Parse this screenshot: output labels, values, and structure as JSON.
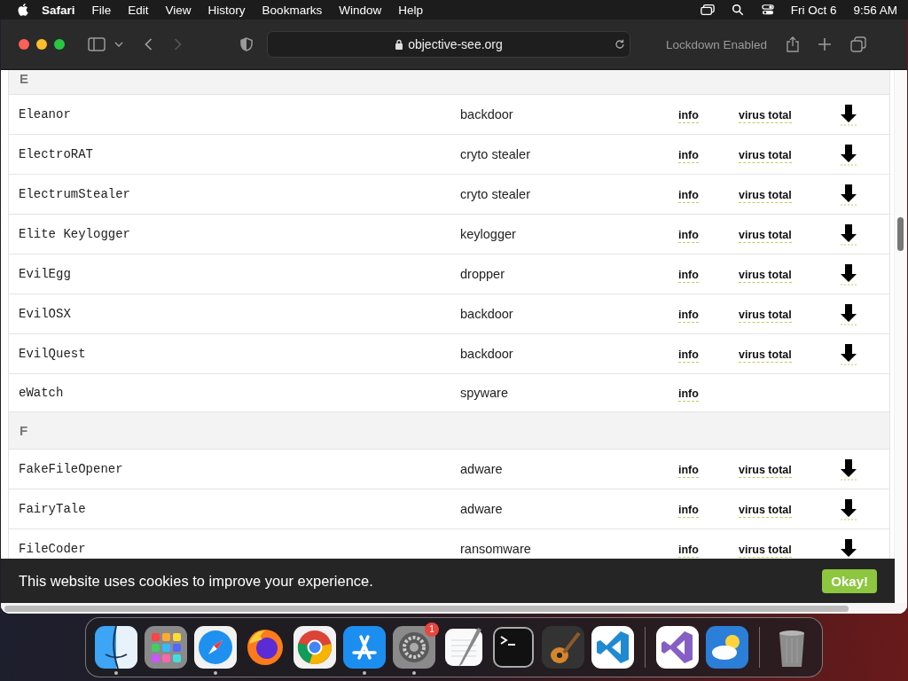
{
  "menubar": {
    "app": "Safari",
    "items": [
      "File",
      "Edit",
      "View",
      "History",
      "Bookmarks",
      "Window",
      "Help"
    ],
    "date": "Fri Oct 6",
    "time": "9:56 AM"
  },
  "toolbar": {
    "address": "objective-see.org",
    "status": "Lockdown Enabled",
    "forward_disabled": true
  },
  "sections": [
    {
      "letter": "E",
      "rows": [
        {
          "name": "Eleanor",
          "type": "backdoor",
          "info": "info",
          "virus_total": "virus total",
          "download": true
        },
        {
          "name": "ElectroRAT",
          "type": "cryto stealer",
          "info": "info",
          "virus_total": "virus total",
          "download": true
        },
        {
          "name": "ElectrumStealer",
          "type": "cryto stealer",
          "info": "info",
          "virus_total": "virus total",
          "download": true
        },
        {
          "name": "Elite Keylogger",
          "type": "keylogger",
          "info": "info",
          "virus_total": "virus total",
          "download": true
        },
        {
          "name": "EvilEgg",
          "type": "dropper",
          "info": "info",
          "virus_total": "virus total",
          "download": true
        },
        {
          "name": "EvilOSX",
          "type": "backdoor",
          "info": "info",
          "virus_total": "virus total",
          "download": true
        },
        {
          "name": "EvilQuest",
          "type": "backdoor",
          "info": "info",
          "virus_total": "virus total",
          "download": true
        },
        {
          "name": "eWatch",
          "type": "spyware",
          "info": "info",
          "download": false
        }
      ]
    },
    {
      "letter": "F",
      "rows": [
        {
          "name": "FakeFileOpener",
          "type": "adware",
          "info": "info",
          "virus_total": "virus total",
          "download": true
        },
        {
          "name": "FairyTale",
          "type": "adware",
          "info": "info",
          "virus_total": "virus total",
          "download": true
        },
        {
          "name": "FileCoder",
          "type": "ransomware",
          "info": "info",
          "virus_total": "virus total",
          "download": true
        }
      ]
    }
  ],
  "cookie_banner": {
    "message": "This website uses cookies to improve your experience.",
    "button": "Okay!"
  },
  "dock": [
    {
      "kind": "finder",
      "running": true
    },
    {
      "kind": "launchpad",
      "running": false
    },
    {
      "kind": "safari",
      "running": true
    },
    {
      "kind": "firefox",
      "running": false
    },
    {
      "kind": "chrome",
      "running": false
    },
    {
      "kind": "appstore",
      "running": true
    },
    {
      "kind": "settings",
      "running": true,
      "badge": "1"
    },
    {
      "kind": "textedit",
      "running": false
    },
    {
      "kind": "terminal",
      "running": false
    },
    {
      "kind": "garageband",
      "running": false
    },
    {
      "kind": "vscode",
      "running": false
    },
    {
      "kind": "separator"
    },
    {
      "kind": "visualstudio",
      "running": false
    },
    {
      "kind": "weather",
      "running": false
    },
    {
      "kind": "separator"
    },
    {
      "kind": "trash",
      "running": false
    }
  ]
}
